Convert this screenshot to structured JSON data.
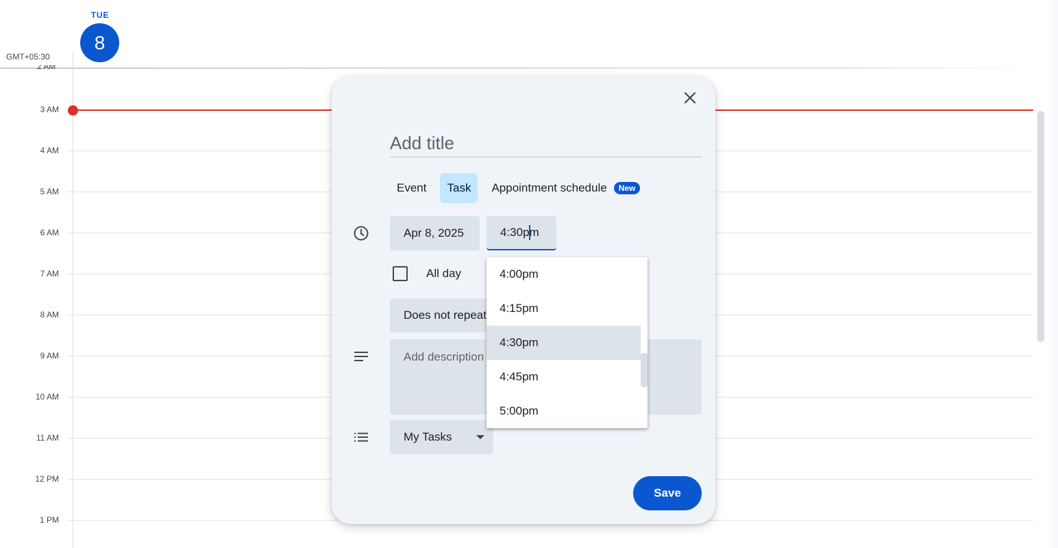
{
  "calendar": {
    "day_name": "TUE",
    "day_number": "8",
    "timezone": "GMT+05:30",
    "top_clipped_hour": "2 AM",
    "hours": [
      "3 AM",
      "4 AM",
      "5 AM",
      "6 AM",
      "7 AM",
      "8 AM",
      "9 AM",
      "10 AM",
      "11 AM",
      "12 PM",
      "1 PM"
    ]
  },
  "dialog": {
    "title_placeholder": "Add title",
    "tabs": [
      {
        "label": "Event",
        "selected": false
      },
      {
        "label": "Task",
        "selected": true
      },
      {
        "label": "Appointment schedule",
        "selected": false,
        "badge": "New"
      }
    ],
    "date": "Apr 8, 2025",
    "time_before_caret": "4:30p",
    "time_after_caret": "m",
    "all_day_label": "All day",
    "all_day_checked": false,
    "repeat": "Does not repeat",
    "description_placeholder": "Add description",
    "task_list": "My Tasks",
    "save_label": "Save"
  },
  "time_dropdown": {
    "options": [
      "4:00pm",
      "4:15pm",
      "4:30pm",
      "4:45pm",
      "5:00pm"
    ],
    "highlighted": "4:30pm"
  },
  "colors": {
    "accent": "#0b57d0",
    "now_indicator": "#d93025",
    "selected_tab": "#c2e7ff",
    "dialog_bg": "#f0f4f9",
    "chip_bg": "#dde3ea"
  }
}
